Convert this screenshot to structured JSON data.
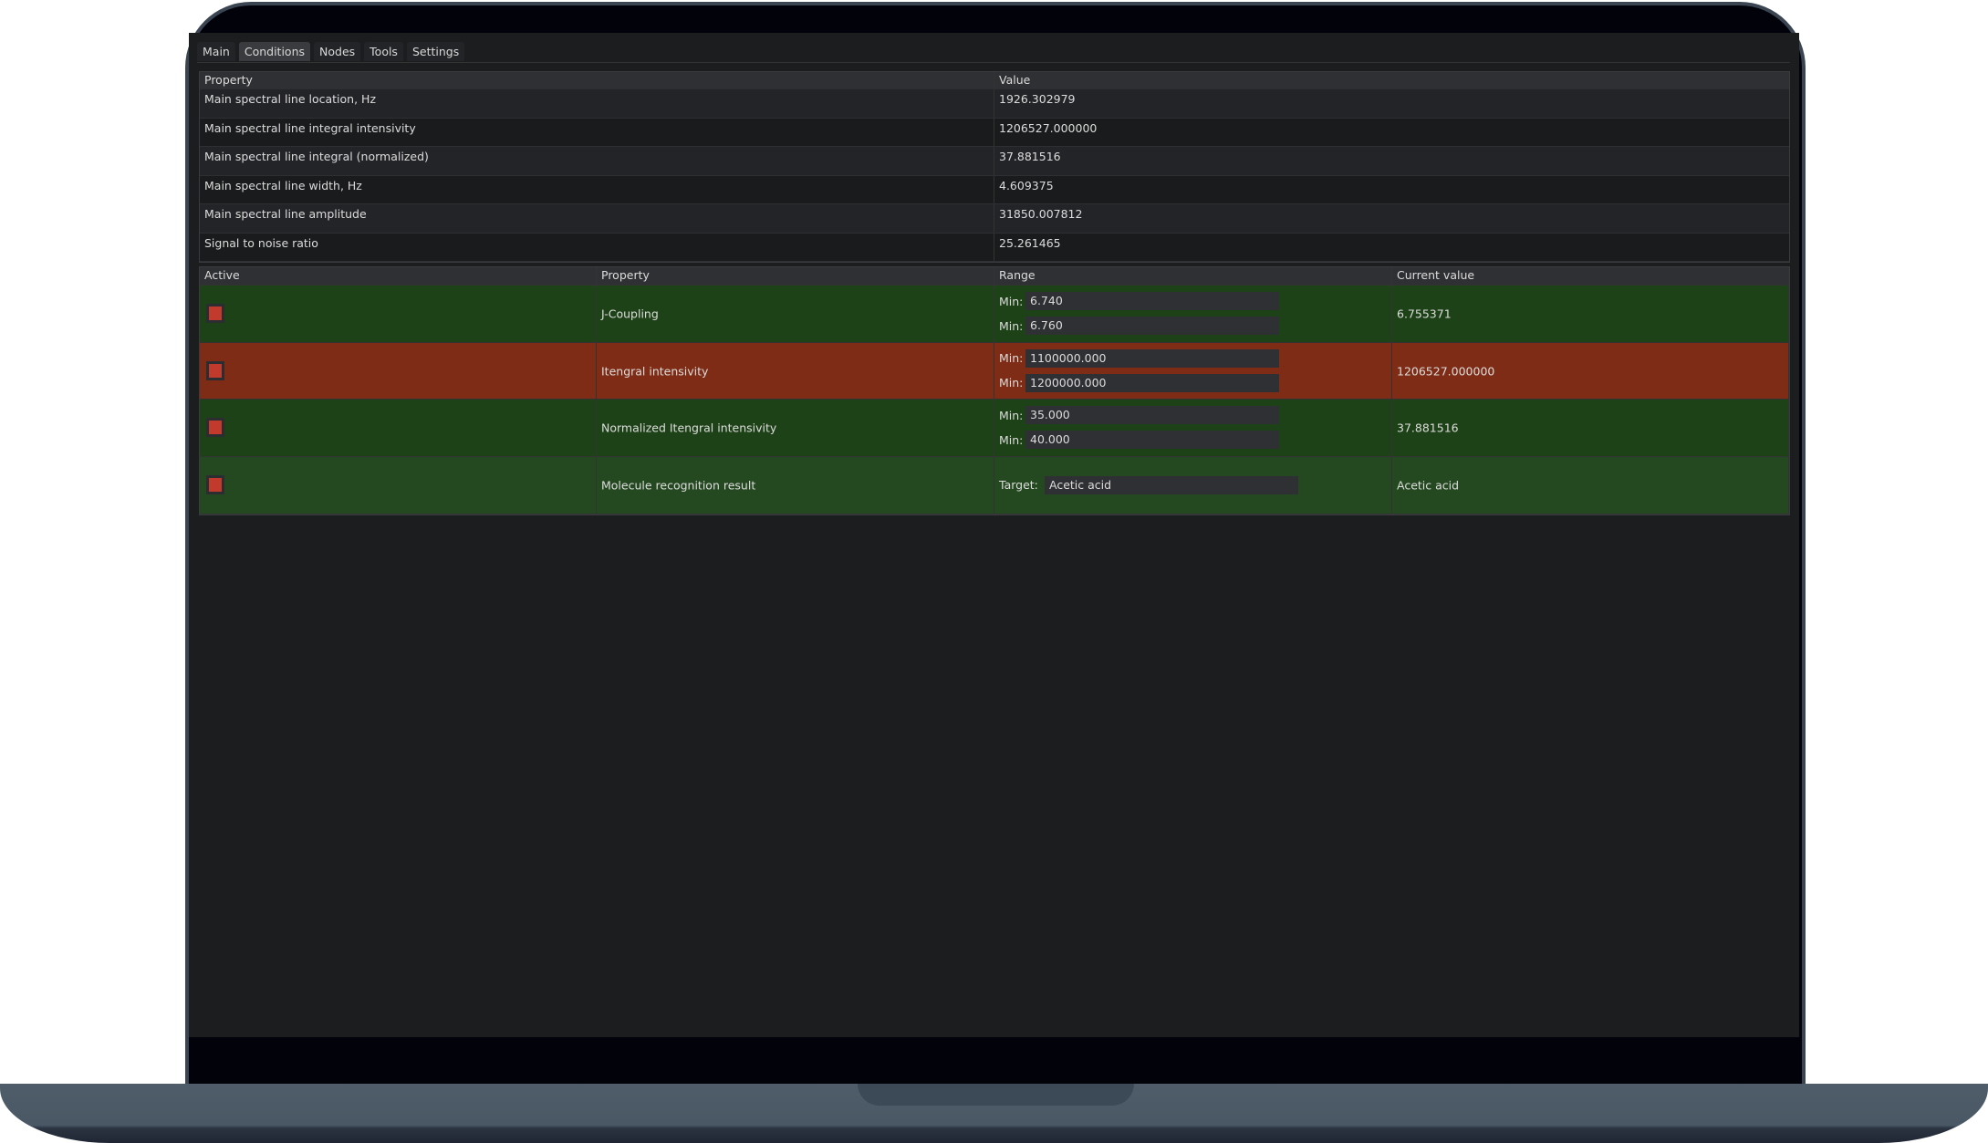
{
  "tabs": [
    "Main",
    "Conditions",
    "Nodes",
    "Tools",
    "Settings"
  ],
  "active_tab": "Conditions",
  "properties": {
    "headers": [
      "Property",
      "Value"
    ],
    "rows": [
      [
        "Main spectral line location, Hz",
        "1926.302979"
      ],
      [
        "Main spectral line integral intensivity",
        "1206527.000000"
      ],
      [
        "Main spectral line integral (normalized)",
        "37.881516"
      ],
      [
        "Main spectral line width, Hz",
        "4.609375"
      ],
      [
        "Main spectral line amplitude",
        "31850.007812"
      ],
      [
        "Signal to noise ratio",
        "25.261465"
      ]
    ]
  },
  "conditions": {
    "headers": [
      "Active",
      "Property",
      "Range",
      "Current value"
    ],
    "colors": {
      "pass": "#1e4217",
      "fail": "#7e2c15",
      "pass_alt": "#244920",
      "checkbox": "#c13a2b"
    },
    "rows": [
      {
        "property": "J-Coupling",
        "min_label": "Min:",
        "min": "6.740",
        "max_label": "Min:",
        "max": "6.760",
        "current": "6.755371",
        "status": "pass"
      },
      {
        "property": "Itengral intensivity",
        "min_label": "Min:",
        "min": "1100000.000",
        "max_label": "Min:",
        "max": "1200000.000",
        "current": "1206527.000000",
        "status": "fail"
      },
      {
        "property": "Normalized Itengral intensivity",
        "min_label": "Min:",
        "min": "35.000",
        "max_label": "Min:",
        "max": "40.000",
        "current": "37.881516",
        "status": "pass"
      },
      {
        "property": "Molecule recognition result",
        "target_label": "Target:",
        "target": "Acetic acid",
        "current": "Acetic acid",
        "status": "pass"
      }
    ]
  }
}
